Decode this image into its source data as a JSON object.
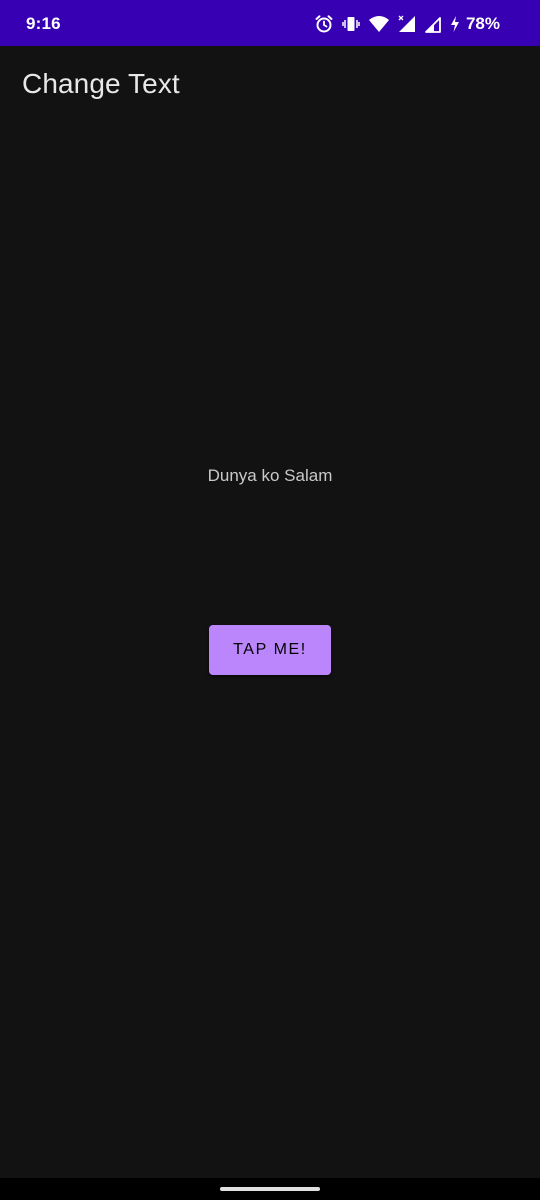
{
  "status_bar": {
    "time": "9:16",
    "battery_percent": "78%",
    "icons": [
      "alarm-icon",
      "vibrate-icon",
      "wifi-icon",
      "signal-icon",
      "signal-icon",
      "charging-icon"
    ],
    "background_color": "#3700b3"
  },
  "app_bar": {
    "title": "Change Text"
  },
  "main": {
    "message": "Dunya ko Salam",
    "button_label": "TAP ME!"
  },
  "colors": {
    "background": "#121212",
    "accent": "#bb86fc"
  }
}
